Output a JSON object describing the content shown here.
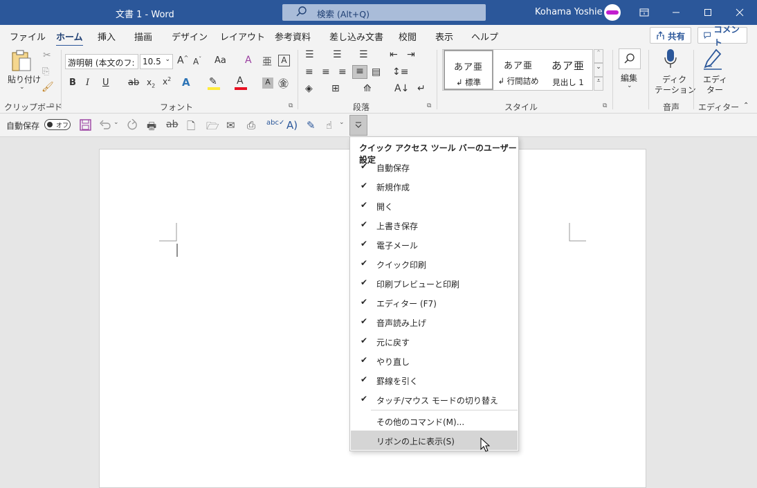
{
  "title": {
    "doc": "文書 1  -  Word",
    "search": "検索 (Alt+Q)",
    "user": "Kohama Yoshie"
  },
  "tabs": [
    "ファイル",
    "ホーム",
    "挿入",
    "描画",
    "デザイン",
    "レイアウト",
    "参考資料",
    "差し込み文書",
    "校閲",
    "表示",
    "ヘルプ"
  ],
  "share": {
    "share": "共有",
    "comment": "コメント"
  },
  "ribbon": {
    "paste": "貼り付け",
    "font_name": "游明朝 (本文のフ:",
    "font_size": "10.5",
    "case": "Aa",
    "styles": [
      {
        "sample": "あア亜",
        "name": "↲ 標準"
      },
      {
        "sample": "あア亜",
        "name": "↲ 行間詰め"
      },
      {
        "sample": "あア亜",
        "name": "見出し 1"
      }
    ],
    "edit": "編集",
    "dictate_1": "ディク",
    "dictate_2": "テーション",
    "editor_1": "エディ",
    "editor_2": "ター",
    "groups": {
      "clipboard": "クリップボード",
      "font": "フォント",
      "paragraph": "段落",
      "style": "スタイル",
      "voice": "音声",
      "editor": "エディター"
    }
  },
  "qat": {
    "autosave": "自動保存",
    "toggle": "オフ"
  },
  "menu": {
    "header": "クイック アクセス ツール バーのユーザー設定",
    "items": [
      "自動保存",
      "新規作成",
      "開く",
      "上書き保存",
      "電子メール",
      "クイック印刷",
      "印刷プレビューと印刷",
      "エディター (F7)",
      "音声読み上げ",
      "元に戻す",
      "やり直し",
      "罫線を引く",
      "タッチ/マウス モードの切り替え"
    ],
    "more": "その他のコマンド(M)...",
    "below": "リボンの上に表示(S)"
  },
  "colors": {
    "title_bar": "#2b579a",
    "highlight": "#ffeb3b",
    "font_color": "#e81123"
  },
  "icons": [
    "search-icon",
    "minimize-icon",
    "maximize-icon",
    "close-icon",
    "save-icon",
    "undo-icon",
    "redo-icon",
    "check-icon",
    "pointer-cursor-icon"
  ]
}
